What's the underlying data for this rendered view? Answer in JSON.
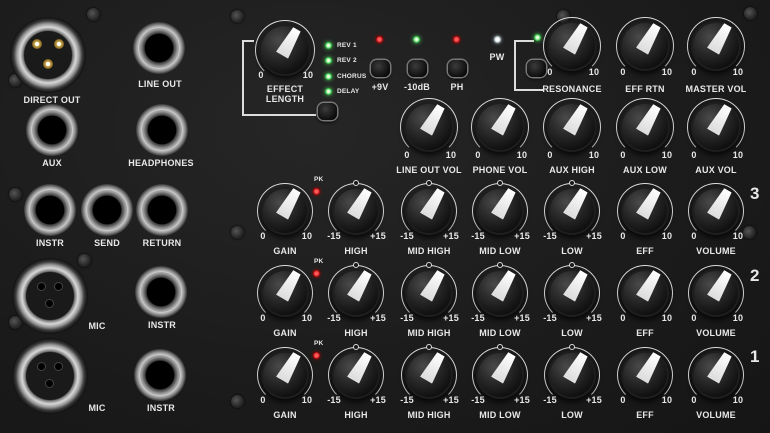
{
  "jacks": {
    "direct_out": "DIRECT OUT",
    "line_out": "LINE OUT",
    "aux": "AUX",
    "headphones": "HEADPHONES",
    "instr": "INSTR",
    "send": "SEND",
    "return": "RETURN",
    "mic": "MIC"
  },
  "effects": {
    "effect_length": "EFFECT\nLENGTH",
    "options": [
      "REV 1",
      "REV 2",
      "CHORUS",
      "DELAY"
    ]
  },
  "switches": {
    "plus9v": "+9V",
    "minus10db": "-10dB",
    "ph": "PH",
    "pw": "PW"
  },
  "scale": {
    "zero": "0",
    "ten": "10",
    "minus15": "-15",
    "plus15": "+15"
  },
  "pk": "PK",
  "top_knobs": [
    "RESONANCE",
    "EFF RTN",
    "MASTER VOL"
  ],
  "output_knobs": [
    "LINE OUT VOL",
    "PHONE VOL",
    "AUX HIGH",
    "AUX LOW",
    "AUX VOL"
  ],
  "channels": [
    {
      "number": "3",
      "labels": [
        "GAIN",
        "HIGH",
        "MID HIGH",
        "MID LOW",
        "LOW",
        "EFF",
        "VOLUME"
      ]
    },
    {
      "number": "2",
      "labels": [
        "GAIN",
        "HIGH",
        "MID HIGH",
        "MID LOW",
        "LOW",
        "EFF",
        "VOLUME"
      ]
    },
    {
      "number": "1",
      "labels": [
        "GAIN",
        "HIGH",
        "MID HIGH",
        "MID LOW",
        "LOW",
        "EFF",
        "VOLUME"
      ]
    }
  ],
  "colors": {
    "panel": "#1c1c1c",
    "text": "#e8e8e8",
    "led_red": "#d40000",
    "led_green": "#49d35a"
  }
}
